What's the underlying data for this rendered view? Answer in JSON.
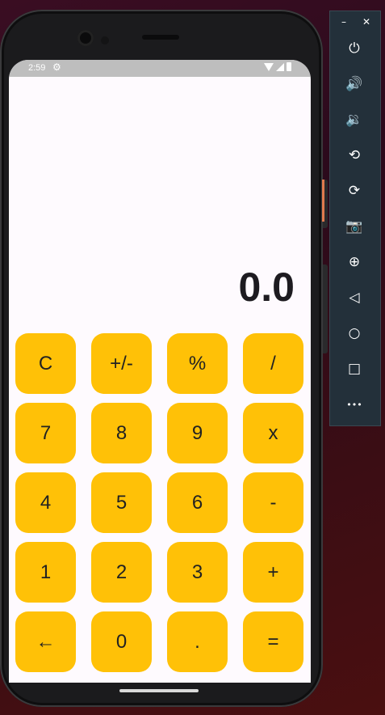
{
  "status_bar": {
    "time": "2:59"
  },
  "display": {
    "value": "0.0"
  },
  "keys": [
    [
      "C",
      "+/-",
      "%",
      "/"
    ],
    [
      "7",
      "8",
      "9",
      "x"
    ],
    [
      "4",
      "5",
      "6",
      "-"
    ],
    [
      "1",
      "2",
      "3",
      "+"
    ],
    [
      "←",
      "0",
      ".",
      "="
    ]
  ],
  "colors": {
    "key_background": "#ffc107",
    "screen_background": "#fefafe",
    "display_text": "#1d1b20",
    "status_bar": "#bebebe",
    "toolbar": "#23303a"
  },
  "emulator_toolbar": {
    "window_controls": {
      "minimize": "–",
      "close": "✕"
    },
    "buttons": [
      {
        "name": "power-icon",
        "glyph": "⏻"
      },
      {
        "name": "volume-up-icon",
        "glyph": "🔊"
      },
      {
        "name": "volume-down-icon",
        "glyph": "🔉"
      },
      {
        "name": "rotate-left-icon",
        "glyph": "⟲"
      },
      {
        "name": "rotate-right-icon",
        "glyph": "⟳"
      },
      {
        "name": "camera-icon",
        "glyph": "📷"
      },
      {
        "name": "zoom-icon",
        "glyph": "⊕"
      },
      {
        "name": "back-icon",
        "glyph": "◁"
      },
      {
        "name": "home-icon",
        "glyph": "○"
      },
      {
        "name": "overview-icon",
        "glyph": "□"
      },
      {
        "name": "more-icon",
        "glyph": "•••"
      }
    ]
  }
}
